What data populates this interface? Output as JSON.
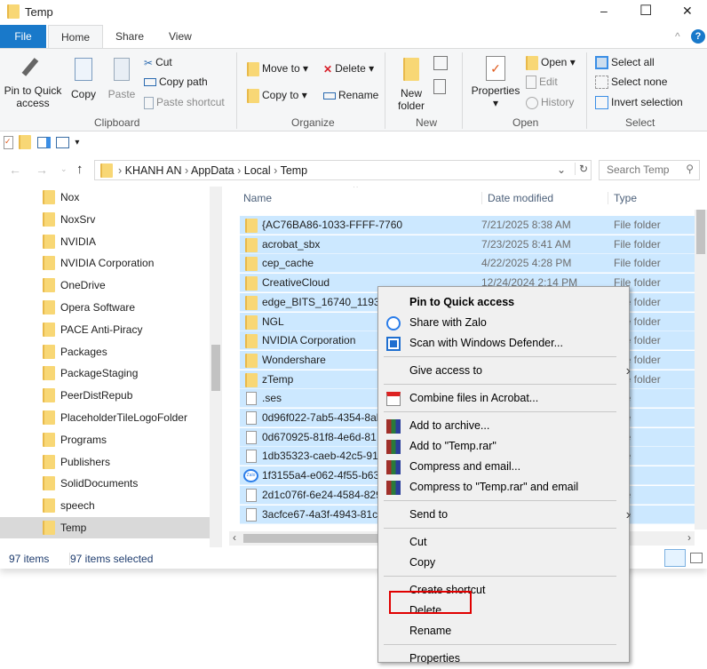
{
  "window": {
    "title": "Temp",
    "min": "–",
    "max": "☐",
    "close": "✕"
  },
  "tabs": [
    "File",
    "Home",
    "Share",
    "View"
  ],
  "ribbon": {
    "clipboard": {
      "pin": "Pin to Quick access",
      "copy": "Copy",
      "paste": "Paste",
      "cut": "Cut",
      "copy_path": "Copy path",
      "paste_shortcut": "Paste shortcut",
      "label": "Clipboard"
    },
    "organize": {
      "move_to": "Move to",
      "copy_to": "Copy to",
      "delete": "Delete",
      "rename": "Rename",
      "label": "Organize"
    },
    "new": {
      "new_folder": "New folder",
      "label": "New"
    },
    "open": {
      "properties": "Properties",
      "open": "Open",
      "edit": "Edit",
      "history": "History",
      "label": "Open"
    },
    "select": {
      "select_all": "Select all",
      "select_none": "Select none",
      "invert": "Invert selection",
      "label": "Select"
    }
  },
  "address": {
    "crumbs": [
      "KHANH AN",
      "AppData",
      "Local",
      "Temp"
    ],
    "search_placeholder": "Search Temp"
  },
  "nav": [
    "Nox",
    "NoxSrv",
    "NVIDIA",
    "NVIDIA Corporation",
    "OneDrive",
    "Opera Software",
    "PACE Anti-Piracy",
    "Packages",
    "PackageStaging",
    "PeerDistRepub",
    "PlaceholderTileLogoFolder",
    "Programs",
    "Publishers",
    "SolidDocuments",
    "speech",
    "Temp"
  ],
  "nav_selected": "Temp",
  "columns": {
    "name": "Name",
    "date": "Date modified",
    "type": "Type"
  },
  "files": [
    {
      "name": "{AC76BA86-1033-FFFF-7760",
      "date": "7/21/2025 8:38 AM",
      "type": "File folder",
      "kind": "folder"
    },
    {
      "name": "acrobat_sbx",
      "date": "7/23/2025 8:41 AM",
      "type": "File folder",
      "kind": "folder"
    },
    {
      "name": "cep_cache",
      "date": "4/22/2025 4:28 PM",
      "type": "File folder",
      "kind": "folder"
    },
    {
      "name": "CreativeCloud",
      "date": "12/24/2024 2:14 PM",
      "type": "File folder",
      "kind": "folder"
    },
    {
      "name": "edge_BITS_16740_119356",
      "date": "",
      "type": "File folder",
      "kind": "folder"
    },
    {
      "name": "NGL",
      "date": "",
      "type": "File folder",
      "kind": "folder"
    },
    {
      "name": "NVIDIA Corporation",
      "date": "",
      "type": "File folder",
      "kind": "folder"
    },
    {
      "name": "Wondershare",
      "date": "",
      "type": "File folder",
      "kind": "folder"
    },
    {
      "name": "zTemp",
      "date": "",
      "type": "File folder",
      "kind": "folder"
    },
    {
      "name": ".ses",
      "date": "",
      "type": "File",
      "kind": "file"
    },
    {
      "name": "0d96f022-7ab5-4354-8al",
      "date": "",
      "type": "File",
      "kind": "file"
    },
    {
      "name": "0d670925-81f8-4e6d-81",
      "date": "",
      "type": "File",
      "kind": "file"
    },
    {
      "name": "1db35323-caeb-42c5-91",
      "date": "",
      "type": "File",
      "kind": "file"
    },
    {
      "name": "1f3155a4-e062-4f55-b63",
      "date": "",
      "type": "",
      "kind": "zalo"
    },
    {
      "name": "2d1c076f-6e24-4584-829",
      "date": "",
      "type": "File",
      "kind": "file"
    },
    {
      "name": "3acfce67-4a3f-4943-81c",
      "date": "",
      "type": "File",
      "kind": "file"
    }
  ],
  "status": {
    "count": "97 items",
    "selected": "97 items selected"
  },
  "context_menu": [
    {
      "label": "Pin to Quick access",
      "bold": true
    },
    {
      "label": "Share with Zalo",
      "icon": "zalo"
    },
    {
      "label": "Scan with Windows Defender...",
      "icon": "defender"
    },
    {
      "sep": true
    },
    {
      "label": "Give access to",
      "submenu": true
    },
    {
      "sep": true
    },
    {
      "label": "Combine files in Acrobat...",
      "icon": "acrobat"
    },
    {
      "sep": true
    },
    {
      "label": "Add to archive...",
      "icon": "winrar"
    },
    {
      "label": "Add to \"Temp.rar\"",
      "icon": "winrar"
    },
    {
      "label": "Compress and email...",
      "icon": "winrar"
    },
    {
      "label": "Compress to \"Temp.rar\" and email",
      "icon": "winrar"
    },
    {
      "sep": true
    },
    {
      "label": "Send to",
      "submenu": true
    },
    {
      "sep": true
    },
    {
      "label": "Cut"
    },
    {
      "label": "Copy"
    },
    {
      "sep": true
    },
    {
      "label": "Create shortcut"
    },
    {
      "label": "Delete",
      "highlighted": true
    },
    {
      "label": "Rename"
    },
    {
      "sep": true
    },
    {
      "label": "Properties"
    }
  ],
  "colors": {
    "accent": "#1979ca",
    "selection": "#cce8ff",
    "highlight_box": "#e00000"
  }
}
